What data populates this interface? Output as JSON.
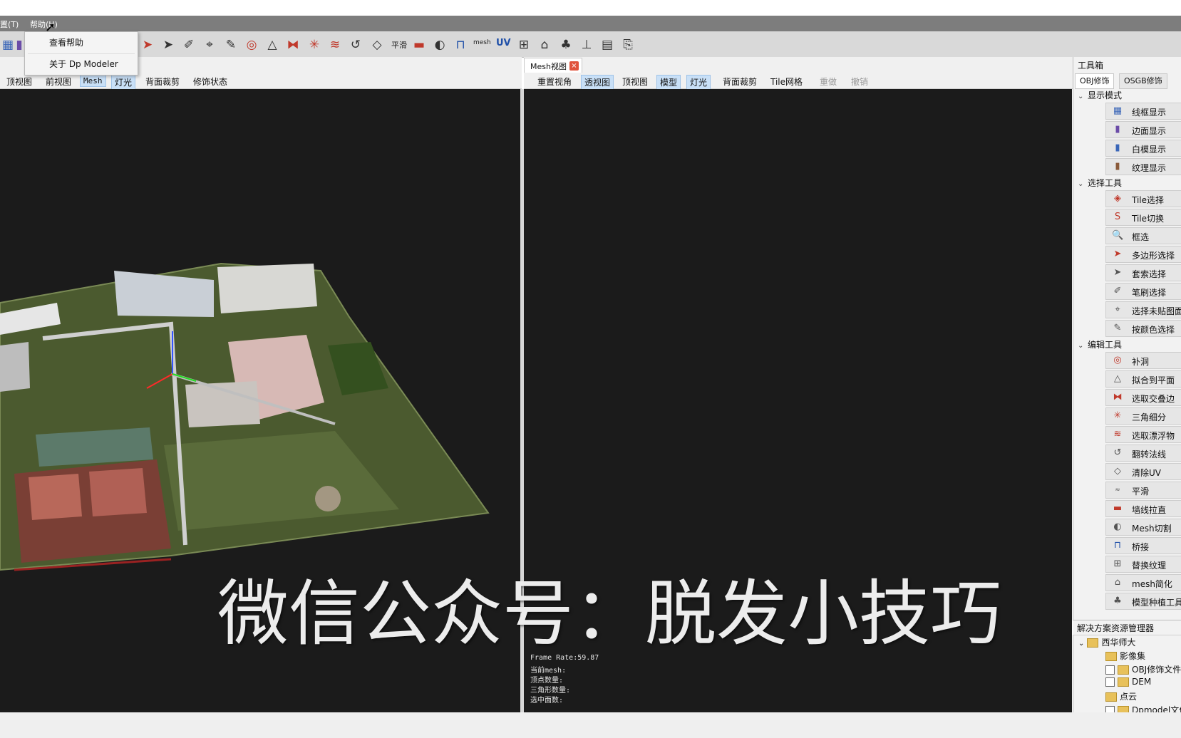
{
  "menu": {
    "settings": "置(T)",
    "help": "帮助(H)"
  },
  "help_menu": {
    "items": [
      "查看帮助",
      "关于 Dp Modeler"
    ]
  },
  "toolbar": {
    "smooth_label": "平滑",
    "mesh_label": "mesh",
    "uv_label": "UV"
  },
  "left_view": {
    "tabs": [
      "顶视图",
      "前视图",
      "Mesh",
      "灯光",
      "背面裁剪",
      "修饰状态"
    ]
  },
  "right_view": {
    "tab_title": "Mesh视图",
    "tabs": [
      "重置视角",
      "透视图",
      "顶视图",
      "模型",
      "灯光",
      "背面裁剪",
      "Tile网格",
      "重做",
      "撤销"
    ],
    "stats": [
      "Frame Rate:59.87",
      "当前mesh:",
      "顶点数量:",
      "三角形数量:",
      "选中面数:"
    ]
  },
  "toolbox": {
    "title": "工具箱",
    "tabs": [
      "OBJ修饰",
      "OSGB修饰"
    ],
    "groups": [
      {
        "label": "显示模式",
        "items": [
          "线框显示",
          "边面显示",
          "白模显示",
          "纹理显示"
        ]
      },
      {
        "label": "选择工具",
        "items": [
          "Tile选择",
          "Tile切换",
          "框选",
          "多边形选择",
          "套索选择",
          "笔刷选择",
          "选择未贴图面",
          "按颜色选择"
        ]
      },
      {
        "label": "编辑工具",
        "items": [
          "补洞",
          "拟合到平面",
          "选取交叠边",
          "三角细分",
          "选取漂浮物",
          "翻转法线",
          "清除UV",
          "平滑",
          "墙线拉直",
          "Mesh切割",
          "桥接",
          "替换纹理",
          "mesh简化",
          "模型种植工具"
        ]
      }
    ]
  },
  "solution": {
    "title": "解决方案资源管理器",
    "root": "西华师大",
    "items": [
      "影像集",
      "OBJ修饰文件",
      "DEM",
      "点云",
      "Dpmodel文件"
    ]
  },
  "watermark": "微信公众号：脱发小技巧",
  "colors": {
    "viewport_bg": "#1b1b1b",
    "active_tab": "#c9e0f7",
    "menubar": "#7d7d7d"
  }
}
